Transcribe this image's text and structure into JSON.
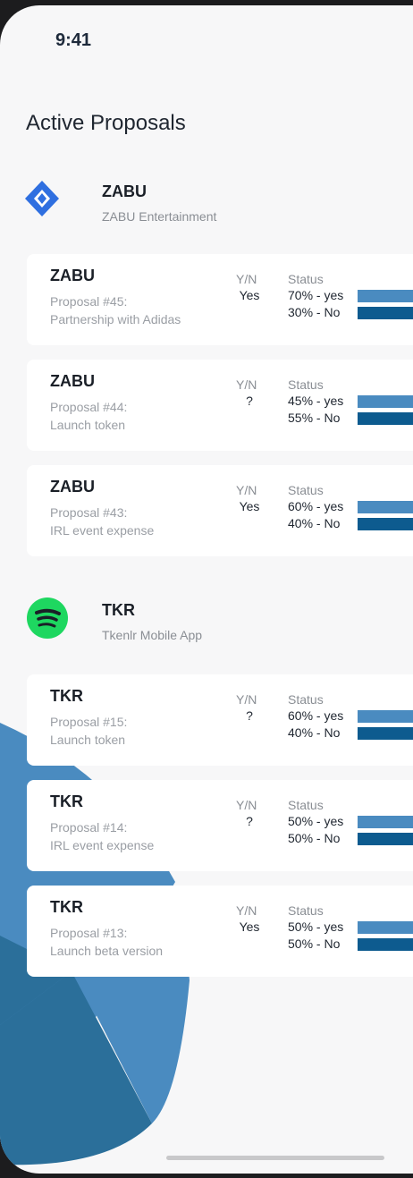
{
  "status_bar": {
    "time": "9:41"
  },
  "page": {
    "title": "Active Proposals"
  },
  "groups": [
    {
      "name": "ZABU",
      "subtitle": "ZABU Entertainment",
      "logo_icon": "zabu-diamond-logo",
      "proposals": [
        {
          "title": "ZABU",
          "number": "Proposal #45:",
          "desc": "Partnership with Adidas",
          "yn_header": "Y/N",
          "yn": "Yes",
          "status_header": "Status",
          "yes_label": "70% - yes",
          "no_label": "30% - No",
          "yes_pct": 70,
          "no_pct": 30
        },
        {
          "title": "ZABU",
          "number": "Proposal #44:",
          "desc": "Launch token",
          "yn_header": "Y/N",
          "yn": "?",
          "status_header": "Status",
          "yes_label": "45% - yes",
          "no_label": "55% - No",
          "yes_pct": 45,
          "no_pct": 55
        },
        {
          "title": "ZABU",
          "number": "Proposal #43:",
          "desc": "IRL event expense",
          "yn_header": "Y/N",
          "yn": "Yes",
          "status_header": "Status",
          "yes_label": "60% - yes",
          "no_label": "40% - No",
          "yes_pct": 60,
          "no_pct": 40
        }
      ]
    },
    {
      "name": "TKR",
      "subtitle": "Tkenlr Mobile App",
      "logo_icon": "spotify-logo",
      "proposals": [
        {
          "title": "TKR",
          "number": "Proposal #15:",
          "desc": "Launch token",
          "yn_header": "Y/N",
          "yn": "?",
          "status_header": "Status",
          "yes_label": "60% - yes",
          "no_label": "40% - No",
          "yes_pct": 60,
          "no_pct": 40
        },
        {
          "title": "TKR",
          "number": "Proposal #14:",
          "desc": "IRL event expense",
          "yn_header": "Y/N",
          "yn": "?",
          "status_header": "Status",
          "yes_label": "50% - yes",
          "no_label": "50% - No",
          "yes_pct": 50,
          "no_pct": 50
        },
        {
          "title": "TKR",
          "number": "Proposal #13:",
          "desc": "Launch beta version",
          "yn_header": "Y/N",
          "yn": "Yes",
          "status_header": "Status",
          "yes_label": "50% - yes",
          "no_label": "50% - No",
          "yes_pct": 50,
          "no_pct": 50
        }
      ]
    }
  ],
  "colors": {
    "bar_yes": "#4a8bc0",
    "bar_no": "#0d5b8f",
    "zabu_logo": "#2f6fe0",
    "spotify_logo": "#1ed760"
  }
}
